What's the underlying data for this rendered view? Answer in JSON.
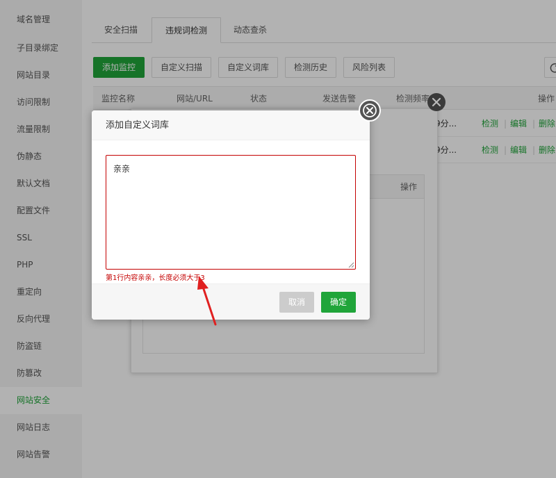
{
  "sidebar": {
    "items": [
      {
        "label": "域名管理"
      },
      {
        "label": "子目录绑定"
      },
      {
        "label": "网站目录"
      },
      {
        "label": "访问限制"
      },
      {
        "label": "流量限制"
      },
      {
        "label": "伪静态"
      },
      {
        "label": "默认文档"
      },
      {
        "label": "配置文件"
      },
      {
        "label": "SSL"
      },
      {
        "label": "PHP"
      },
      {
        "label": "重定向"
      },
      {
        "label": "反向代理"
      },
      {
        "label": "防盗链"
      },
      {
        "label": "防篡改"
      },
      {
        "label": "网站安全",
        "active": true
      },
      {
        "label": "网站日志"
      },
      {
        "label": "网站告警"
      }
    ]
  },
  "tabs": [
    {
      "label": "安全扫描"
    },
    {
      "label": "违规词检测",
      "active": true
    },
    {
      "label": "动态查杀"
    }
  ],
  "toolbar": {
    "add_monitor": "添加监控",
    "custom_scan": "自定义扫描",
    "custom_lexicon": "自定义词库",
    "history": "检测历史",
    "risk_list": "风险列表"
  },
  "table": {
    "headers": [
      "监控名称",
      "网站/URL",
      "状态",
      "发送告警",
      "检测频率",
      "操作"
    ],
    "rows": [
      {
        "freq": "9分...",
        "actions": [
          "检测",
          "编辑",
          "删除"
        ]
      },
      {
        "freq": "9分...",
        "actions": [
          "检测",
          "编辑",
          "删除"
        ]
      }
    ]
  },
  "under_panel": {
    "op_header": "操作"
  },
  "modal": {
    "title": "添加自定义词库",
    "textarea_value": "亲亲",
    "error": "第1行内容亲亲，长度必须大于3",
    "cancel": "取消",
    "ok": "确定"
  },
  "colors": {
    "accent": "#20a53a",
    "error": "#c40000"
  }
}
